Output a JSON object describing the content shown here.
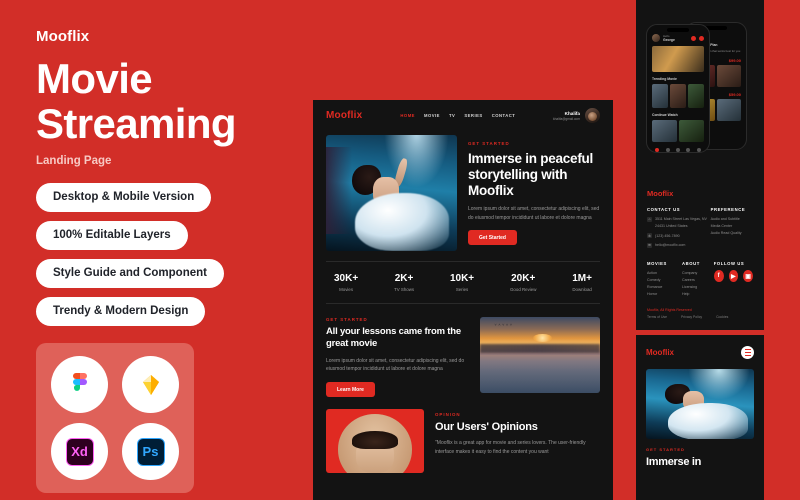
{
  "left": {
    "brand": "Mooflix",
    "headline_line1": "Movie",
    "headline_line2": "Streaming",
    "subtitle": "Landing Page",
    "pills": [
      "Desktop & Mobile Version",
      "100% Editable Layers",
      "Style Guide and Component",
      "Trendy & Modern Design"
    ],
    "tools": [
      {
        "name": "figma-icon",
        "label": "Figma"
      },
      {
        "name": "sketch-icon",
        "label": "Sketch"
      },
      {
        "name": "adobe-xd-icon",
        "label": "Xd"
      },
      {
        "name": "photoshop-icon",
        "label": "Ps"
      }
    ]
  },
  "desktop": {
    "logo": "Mooflix",
    "nav": [
      {
        "label": "HOME",
        "active": true
      },
      {
        "label": "MOVIE",
        "active": false
      },
      {
        "label": "TV",
        "active": false
      },
      {
        "label": "SERIES",
        "active": false
      },
      {
        "label": "CONTACT",
        "active": false
      }
    ],
    "profile": {
      "name": "Khalifa",
      "email": "khalifa@gmail.com"
    },
    "hero": {
      "eyebrow": "GET STARTED",
      "heading": "Immerse in peaceful storytelling with Mooflix",
      "paragraph": "Lorem ipsum dolor sit amet, consectetur adipiscing elit, sed do eiusmod tempor incididunt ut labore et dolore magna",
      "button": "Get Started",
      "image": "underwater-woman-photo"
    },
    "stats": [
      {
        "value": "30K+",
        "label": "Movies"
      },
      {
        "value": "2K+",
        "label": "TV Shows"
      },
      {
        "value": "10K+",
        "label": "Series"
      },
      {
        "value": "20K+",
        "label": "Good Review"
      },
      {
        "value": "1M+",
        "label": "Download"
      }
    ],
    "section2": {
      "eyebrow": "GET STARTED",
      "heading": "All your lessons came from the great movie",
      "paragraph": "Lorem ipsum dolor sit amet, consectetur adipiscing elit, sed do eiusmod tempor incididunt ut labore et dolore magna",
      "button": "Learn More",
      "image": "sunset-birds-photo"
    },
    "opinions": {
      "eyebrow": "OPINION",
      "heading": "Our Users' Opinions",
      "quote": "\"Mooflix is a great app for movie and series lovers. The user-friendly interface makes it easy to find the content you want",
      "image": "user-portrait-photo"
    }
  },
  "phones": {
    "front": {
      "greeting": "Hello",
      "username": "George",
      "featured": "featured-movie-thumb",
      "sections": [
        {
          "title": "Trending Movie",
          "items": [
            "thumb-1",
            "thumb-2",
            "thumb-3"
          ]
        },
        {
          "title": "Continue Watch",
          "items": [
            "thumb-4",
            "thumb-5",
            "thumb-6"
          ]
        }
      ]
    },
    "back": {
      "title": "Subscribe",
      "subtitle": "Select Your Plan",
      "desc": "Choose the plan that works best for you",
      "plans": [
        {
          "price": "$99.00"
        },
        {
          "price": "$59.00"
        },
        {
          "price": "$19.00"
        }
      ]
    }
  },
  "footer": {
    "logo": "Mooflix",
    "contact": {
      "title": "CONTACT US",
      "address": "3511 Main Street Las Vegas, NV 24431 United States",
      "phone": "(123) 456-7890",
      "email": "hello@mooflix.com"
    },
    "preference": {
      "title": "PREFERENCE",
      "items": [
        "Audio and Subtitle",
        "Media Center",
        "Audio Read Quality"
      ]
    },
    "movies": {
      "title": "MOVIES",
      "items": [
        "Action",
        "Comedy",
        "Romance",
        "Horror"
      ]
    },
    "about": {
      "title": "ABOUT",
      "items": [
        "Company",
        "Careers",
        "Licensing",
        "Help"
      ]
    },
    "follow": {
      "title": "FOLLOW US",
      "items": [
        {
          "name": "facebook-icon",
          "glyph": "f"
        },
        {
          "name": "youtube-icon",
          "glyph": "▶"
        },
        {
          "name": "instagram-icon",
          "glyph": "▣"
        }
      ]
    },
    "copyright": "Mooflix, All Rights Reserved",
    "legal": [
      "Terms of Use",
      "Privacy Policy",
      "Cookies"
    ]
  },
  "mobile": {
    "logo": "Mooflix",
    "eyebrow": "GET STARTED",
    "heading": "Immerse in",
    "image": "underwater-woman-photo"
  },
  "colors": {
    "brand_red": "#d22e28",
    "accent_red": "#e02a22",
    "dark": "#131313",
    "card": "#df6159"
  }
}
